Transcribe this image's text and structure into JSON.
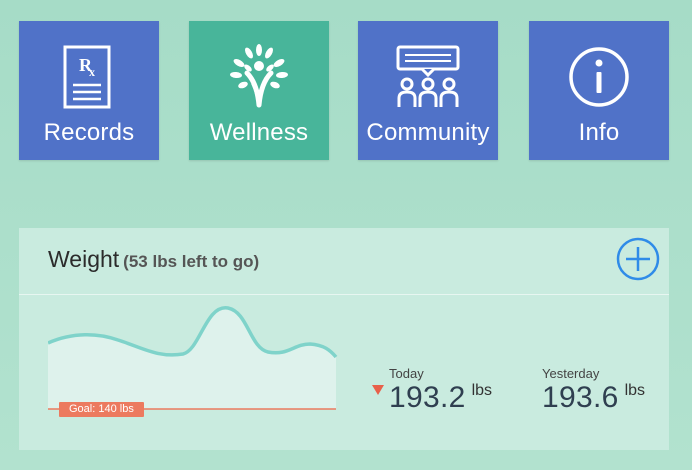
{
  "tiles": [
    {
      "label": "Records",
      "icon": "prescription-document-icon",
      "color": "#5072c8"
    },
    {
      "label": "Wellness",
      "icon": "person-tree-icon",
      "color": "#48b59a"
    },
    {
      "label": "Community",
      "icon": "people-chat-icon",
      "color": "#5072c8"
    },
    {
      "label": "Info",
      "icon": "info-circle-icon",
      "color": "#5072c8"
    }
  ],
  "weight": {
    "title": "Weight",
    "subtitle": "(53 lbs left to go)",
    "add_icon": "plus-circle-icon",
    "goal_label": "Goal: 140 lbs",
    "today_label": "Today",
    "today_value": "193.2",
    "today_unit": "lbs",
    "today_trend": "down",
    "yesterday_label": "Yesterday",
    "yesterday_value": "193.6",
    "yesterday_unit": "lbs"
  },
  "colors": {
    "background": "#a6dcc7",
    "card": "#c9ebdf",
    "blue_tile": "#5072c8",
    "green_tile": "#48b59a",
    "chart_line": "#7fd3ca",
    "goal": "#ec7a5f",
    "accent_blue": "#2f8be8"
  }
}
